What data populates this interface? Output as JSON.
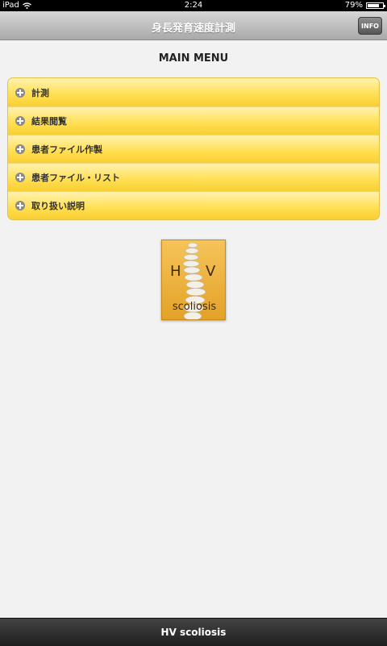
{
  "status_bar": {
    "device": "iPad",
    "time": "2:24",
    "battery_text": "79%",
    "battery_level": 0.79
  },
  "header": {
    "title": "身長発育速度計測",
    "info_label": "INFO"
  },
  "main": {
    "heading": "MAIN MENU",
    "menu_items": [
      {
        "label": "計測"
      },
      {
        "label": "結果閲覧"
      },
      {
        "label": "患者ファイル作製"
      },
      {
        "label": "患者ファイル・リスト"
      },
      {
        "label": "取り扱い説明"
      }
    ]
  },
  "logo": {
    "letter_left": "H",
    "letter_right": "V",
    "word": "scoliosis",
    "color": "#f0b440"
  },
  "footer": {
    "title": "HV scoliosis"
  }
}
